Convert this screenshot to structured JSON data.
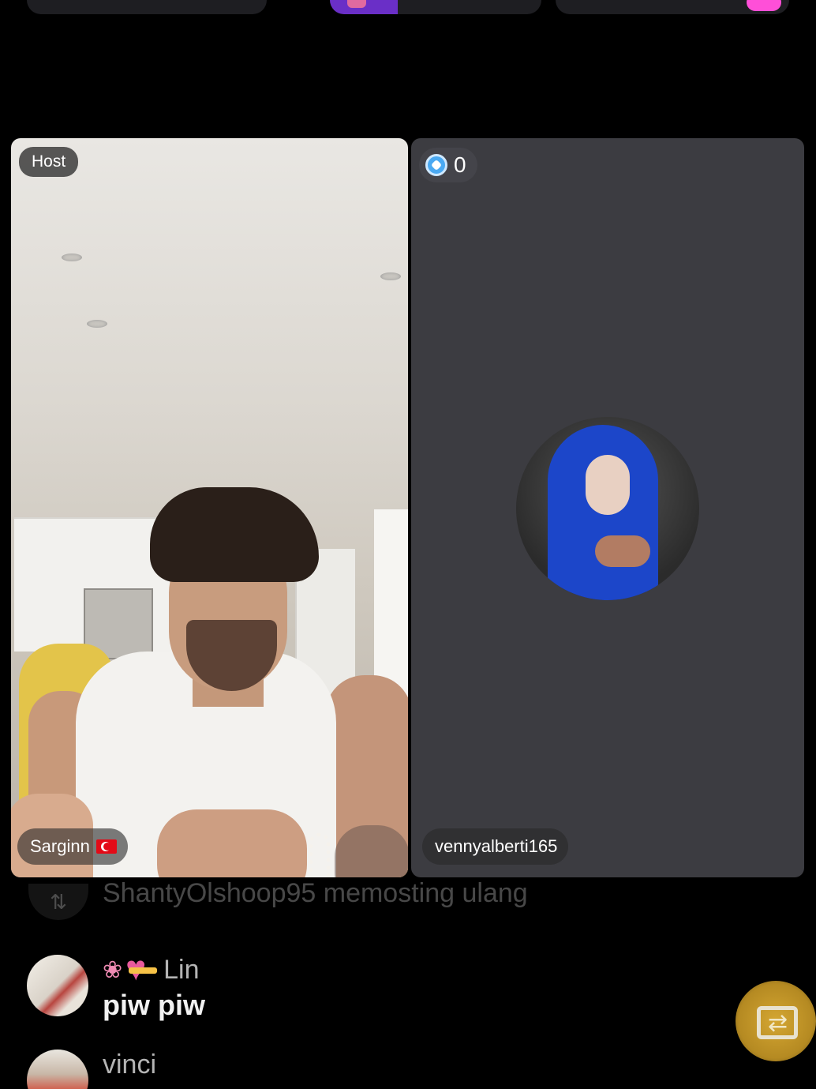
{
  "host_panel": {
    "badge": "Host",
    "username": "Sarginn",
    "flag": "turkey-flag-icon"
  },
  "guest_panel": {
    "score": "0",
    "score_icon": "shield-gem-icon",
    "username": "vennyalberti165"
  },
  "chat": {
    "system_message": "ShantyOlshoop95 memosting ulang",
    "messages": [
      {
        "user": "Lin",
        "text": "piw piw"
      },
      {
        "user": "vinci",
        "text": ""
      }
    ]
  },
  "colors": {
    "background": "#000000",
    "panel_guest": "#3c3c41",
    "repost_button": "#c99c2c"
  }
}
